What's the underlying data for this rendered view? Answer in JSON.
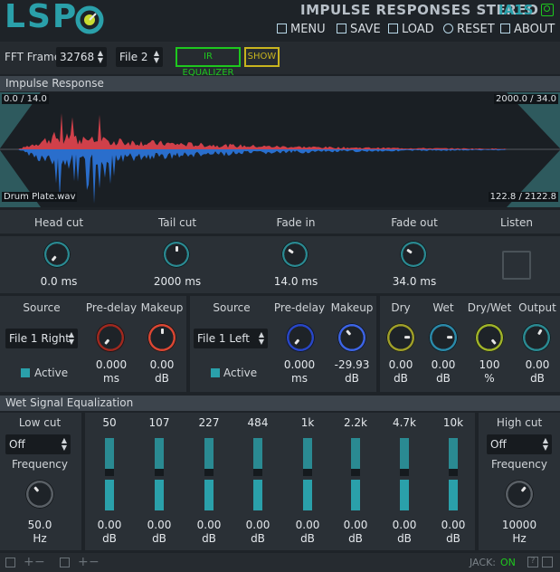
{
  "header": {
    "logo": "LSP",
    "plugin_title": "IMPULSE RESPONSES STEREO",
    "plugin_short": "IA1S",
    "menu": {
      "menu": "MENU",
      "save": "SAVE",
      "load": "LOAD",
      "reset": "RESET",
      "about": "ABOUT"
    }
  },
  "toolbar": {
    "fft_label": "FFT Frame",
    "fft_value": "32768",
    "file_value": "File 2",
    "ir_eq_label": "IR EQUALIZER",
    "show_label": "SHOW"
  },
  "ir": {
    "title": "Impulse Response",
    "top_left": "0.0 / 14.0",
    "top_right": "2000.0 / 34.0",
    "file_name": "Drum Plate.wav",
    "bottom_right": "122.8 / 2122.8"
  },
  "controls": {
    "head_cut": {
      "label": "Head cut",
      "value": "0.0 ms",
      "level": 0.0
    },
    "tail_cut": {
      "label": "Tail cut",
      "value": "2000 ms",
      "level": 0.5
    },
    "fade_in": {
      "label": "Fade in",
      "value": "14.0 ms",
      "level": 0.3
    },
    "fade_out": {
      "label": "Fade out",
      "value": "34.0 ms",
      "level": 0.3
    },
    "listen": {
      "label": "Listen"
    }
  },
  "channel_left": {
    "source_label": "Source",
    "source_value": "File 1 Right",
    "active_label": "Active",
    "predelay_label": "Pre-delay",
    "predelay_value": "0.000",
    "predelay_unit": "ms",
    "makeup_label": "Makeup",
    "makeup_value": "0.00",
    "makeup_unit": "dB"
  },
  "channel_right": {
    "source_label": "Source",
    "source_value": "File 1 Left",
    "active_label": "Active",
    "predelay_label": "Pre-delay",
    "predelay_value": "0.000",
    "predelay_unit": "ms",
    "makeup_label": "Makeup",
    "makeup_value": "-29.93",
    "makeup_unit": "dB"
  },
  "mix": {
    "dry_label": "Dry",
    "dry_value": "0.00",
    "dry_unit": "dB",
    "wet_label": "Wet",
    "wet_value": "0.00",
    "wet_unit": "dB",
    "drywet_label": "Dry/Wet",
    "drywet_value": "100",
    "drywet_unit": "%",
    "output_label": "Output",
    "output_value": "0.00",
    "output_unit": "dB"
  },
  "eq": {
    "title": "Wet Signal Equalization",
    "low_cut_label": "Low cut",
    "low_cut_value": "Off",
    "low_freq_label": "Frequency",
    "low_freq_value": "50.0",
    "low_freq_unit": "Hz",
    "high_cut_label": "High cut",
    "high_cut_value": "Off",
    "high_freq_label": "Frequency",
    "high_freq_value": "10000",
    "high_freq_unit": "Hz",
    "bands": [
      {
        "freq": "50",
        "value": "0.00",
        "unit": "dB"
      },
      {
        "freq": "107",
        "value": "0.00",
        "unit": "dB"
      },
      {
        "freq": "227",
        "value": "0.00",
        "unit": "dB"
      },
      {
        "freq": "484",
        "value": "0.00",
        "unit": "dB"
      },
      {
        "freq": "1k",
        "value": "0.00",
        "unit": "dB"
      },
      {
        "freq": "2.2k",
        "value": "0.00",
        "unit": "dB"
      },
      {
        "freq": "4.7k",
        "value": "0.00",
        "unit": "dB"
      },
      {
        "freq": "10k",
        "value": "0.00",
        "unit": "dB"
      }
    ]
  },
  "footer": {
    "jack_label": "JACK:",
    "jack_status": "ON"
  },
  "colors": {
    "accent": "#2aa0aa",
    "ir_left": "#d0404a",
    "ir_right": "#2a6ecc",
    "green": "#1ec81e",
    "yellow": "#c8b41e"
  }
}
